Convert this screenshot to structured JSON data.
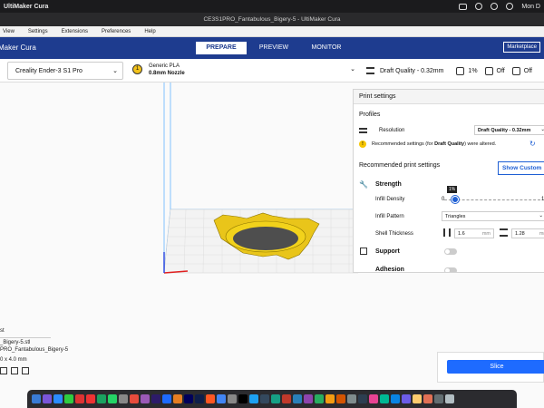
{
  "macos": {
    "app": "UltiMaker Cura",
    "clock": "Mon D"
  },
  "window": {
    "title": "CE3S1PRO_Fantabulous_Bigery-5 - UltiMaker Cura"
  },
  "app_menu": [
    "View",
    "Settings",
    "Extensions",
    "Preferences",
    "Help"
  ],
  "header": {
    "brand": "Maker Cura",
    "tabs": [
      "PREPARE",
      "PREVIEW",
      "MONITOR"
    ],
    "active_tab": "PREPARE",
    "marketplace": "Marketplace"
  },
  "toolbar": {
    "printer": "Creality Ender-3 S1 Pro",
    "material_line1": "Generic PLA",
    "material_line2": "0.8mm Nozzle",
    "profile": "Draft Quality - 0.32mm",
    "infill_summary": "1%",
    "support_summary": "Off",
    "adhesion_summary": "Off"
  },
  "print_settings": {
    "title": "Print settings",
    "profiles_label": "Profiles",
    "resolution_label": "Resolution",
    "resolution_value": "Draft Quality - 0.32mm",
    "notice_prefix": "Recommended settings (for ",
    "notice_profile": "Draft Quality",
    "notice_suffix": ") were altered.",
    "recommended_label": "Recommended print settings",
    "show_custom": "Show Custom",
    "strength": "Strength",
    "infill_density_label": "Infill Density",
    "infill_density": 1,
    "infill_tooltip": "1%",
    "infill_min": "0",
    "infill_max": "1",
    "infill_pattern_label": "Infill Pattern",
    "infill_pattern": "Triangles",
    "shell_thickness_label": "Shell Thickness",
    "shell_wall": "1.6",
    "shell_topbottom": "1.28",
    "unit": "mm",
    "support": "Support",
    "adhesion": "Adhesion"
  },
  "objects": {
    "list_header": "st",
    "file": "_Bigery-5.stl",
    "job_name": "PRO_Fantabulous_Bigery-5",
    "dims": "0 x 4.0 mm"
  },
  "slice": "Slice",
  "colors": {
    "brand_blue": "#1e3c8f",
    "accent": "#1e6bff",
    "model": "#f2d21b",
    "build_plate_grid": "#d8d8d8"
  }
}
